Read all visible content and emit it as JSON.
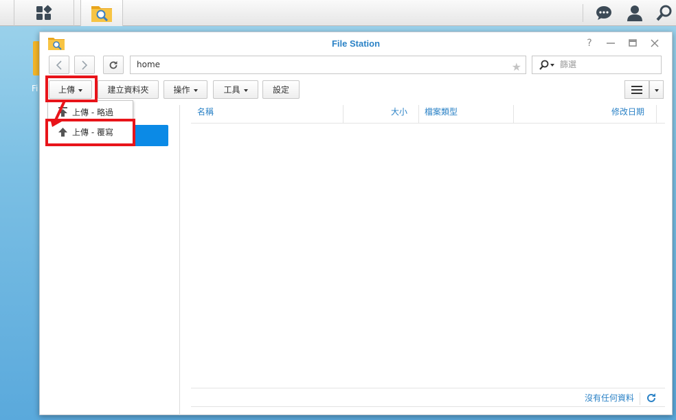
{
  "window": {
    "title": "File Station"
  },
  "desktop": {
    "icon_label_partial": "Fi"
  },
  "toolbar": {
    "path": "home",
    "filter_placeholder": "篩選",
    "upload_label": "上傳",
    "new_folder_label": "建立資料夾",
    "action_label": "操作",
    "tools_label": "工具",
    "settings_label": "設定"
  },
  "upload_menu": {
    "items": [
      {
        "label": "上傳 - 略過"
      },
      {
        "label": "上傳 - 覆寫"
      }
    ]
  },
  "file_list": {
    "columns": [
      "名稱",
      "大小",
      "檔案類型",
      "修改日期"
    ],
    "empty_text": "沒有任何資料"
  },
  "colors": {
    "accent": "#2b82c6",
    "selection": "#0b8ae6",
    "highlight": "#e8141a"
  }
}
